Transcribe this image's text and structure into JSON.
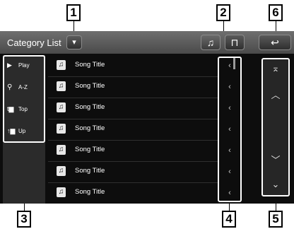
{
  "callouts": [
    "1",
    "2",
    "3",
    "4",
    "5",
    "6"
  ],
  "header": {
    "title": "Category List",
    "dropdown_icon": "▾",
    "music_icon": "♫",
    "video_icon": "⊓",
    "back_icon": "↩"
  },
  "sidebar": {
    "items": [
      {
        "icon": "▶",
        "label": "Play"
      },
      {
        "icon": "🔍",
        "label": "A-Z"
      },
      {
        "icon": "⬛",
        "label": "Top"
      },
      {
        "icon": "⬛",
        "label": "Up"
      }
    ]
  },
  "list": {
    "rows": [
      {
        "icon": "♫",
        "label": "Song Title"
      },
      {
        "icon": "♫",
        "label": "Song Title"
      },
      {
        "icon": "♫",
        "label": "Song Title"
      },
      {
        "icon": "♫",
        "label": "Song Title"
      },
      {
        "icon": "♫",
        "label": "Song Title"
      },
      {
        "icon": "♫",
        "label": "Song Title"
      },
      {
        "icon": "♫",
        "label": "Song Title"
      }
    ],
    "jump_icon": "‹"
  },
  "paging": {
    "top": "⌅",
    "up": "︿",
    "down": "﹀",
    "bottom": "⌄"
  }
}
